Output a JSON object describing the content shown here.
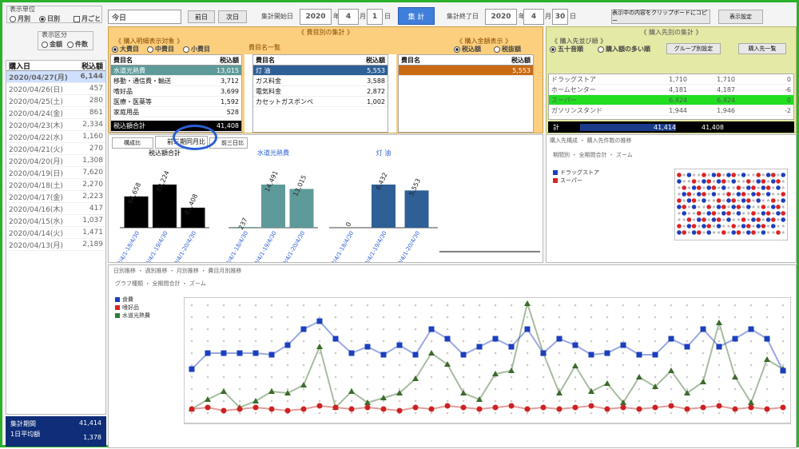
{
  "toolbar": {
    "unit_label": "表示単位",
    "radio_monthly": "月別",
    "radio_daily": "日別",
    "check_label": "月ごと",
    "period": "今日",
    "prev": "前日",
    "next": "次日",
    "start_label": "集計開始日",
    "start_year": "2020",
    "year_unit": "年",
    "start_month": "4",
    "month_unit": "月",
    "start_day": "1",
    "day_unit": "日",
    "aggregate": "集 計",
    "end_label": "集計終了日",
    "end_year": "2020",
    "end_month": "4",
    "end_day": "30",
    "copy": "表示中の内容をクリップボードにコピー",
    "settings": "表示設定",
    "mode_label": "表示区分",
    "mode_a": "金額",
    "mode_b": "件数"
  },
  "left_list": {
    "col_date": "購入日",
    "col_count": "税込額",
    "rows": [
      {
        "date": "2020/04/27(月)",
        "value": "6,144",
        "selected": true
      },
      {
        "date": "2020/04/26(日)",
        "value": "457"
      },
      {
        "date": "2020/04/25(土)",
        "value": "280"
      },
      {
        "date": "2020/04/24(金)",
        "value": "861"
      },
      {
        "date": "2020/04/23(木)",
        "value": "2,334"
      },
      {
        "date": "2020/04/22(水)",
        "value": "1,160"
      },
      {
        "date": "2020/04/21(火)",
        "value": "270"
      },
      {
        "date": "2020/04/20(月)",
        "value": "1,308"
      },
      {
        "date": "2020/04/19(日)",
        "value": "7,620"
      },
      {
        "date": "2020/04/18(土)",
        "value": "2,270"
      },
      {
        "date": "2020/04/17(金)",
        "value": "2,223"
      },
      {
        "date": "2020/04/16(木)",
        "value": "417"
      },
      {
        "date": "2020/04/15(水)",
        "value": "1,037"
      },
      {
        "date": "2020/04/14(火)",
        "value": "1,471"
      },
      {
        "date": "2020/04/13(月)",
        "value": "2,189"
      }
    ],
    "total_label": "集計期間",
    "total_value": "41,414",
    "avg_label": "1日平均額",
    "avg_value": "1,378"
  },
  "category": {
    "title": "《 費目別の集計 》",
    "type_label": "《 購入明細表示対象 》",
    "radio_large": "大費目",
    "radio_medium": "中費目",
    "radio_small": "小費目",
    "list_button": "費目名一覧",
    "amount_label": "《 購入金額表示 》",
    "radio_tax_incl": "税込額",
    "radio_tax_excl": "税抜額",
    "col_name": "費目名",
    "col_amount": "税込額",
    "large": [
      {
        "name": "水道光熱費",
        "value": "13,015",
        "selected": true
      },
      {
        "name": "移動・通信費・輸送",
        "value": "3,712"
      },
      {
        "name": "嗜好品",
        "value": "3,699"
      },
      {
        "name": "医療・医薬等",
        "value": "1,592"
      },
      {
        "name": "家庭用品",
        "value": "528"
      }
    ],
    "medium": [
      {
        "name": "灯 油",
        "value": "5,553",
        "selected": true
      },
      {
        "name": "ガス料金",
        "value": "3,588"
      },
      {
        "name": "電気料金",
        "value": "2,872"
      },
      {
        "name": "カセットガスボンベ",
        "value": "1,002"
      }
    ],
    "small": [
      {
        "name": "",
        "value": "5,553",
        "selected": true
      }
    ],
    "total_label": "税込額合計",
    "total_value": "41,408"
  },
  "compare": {
    "tab_composition": "構成比",
    "tab_same_period": "前三期同月比",
    "tab_prev3": "前三日比",
    "period_labels": [
      "18/4/1-18/4/30",
      "19/4/1-19/4/30",
      "20/4/1-20/4/30"
    ]
  },
  "chart_data": [
    {
      "type": "bar",
      "title": "税込額合計",
      "categories": [
        "18/4/1-18/4/30",
        "19/4/1-19/4/30",
        "20/4/1-20/4/30"
      ],
      "values": [
        64658,
        89224,
        41408
      ],
      "labels": [
        "64,658",
        "89,224",
        "41,408"
      ],
      "color": "#000000"
    },
    {
      "type": "bar",
      "title": "水道光熱費",
      "categories": [
        "18/4/1-18/4/30",
        "19/4/1-19/4/30",
        "20/4/1-20/4/30"
      ],
      "values": [
        237,
        14491,
        13015
      ],
      "labels": [
        "237",
        "14,491",
        "13,015"
      ],
      "color": "#5f9a9a"
    },
    {
      "type": "bar",
      "title": "灯 油",
      "categories": [
        "18/4/1-18/4/30",
        "19/4/1-19/4/30",
        "20/4/1-20/4/30"
      ],
      "values": [
        0,
        6432,
        5553
      ],
      "labels": [
        "0",
        "6,432",
        "5,553"
      ],
      "color": "#2e5f96"
    }
  ],
  "store": {
    "title": "《 購入先別の集計 》",
    "sort_label": "《 購入先並び順 》",
    "sort_a": "五十音順",
    "sort_b": "購入額の多い順",
    "group_button": "グループ別設定",
    "list_button": "購入先一覧",
    "rows": [
      {
        "name": "ドラッグストア",
        "v1": "1,710",
        "v2": "1,710",
        "v3": "0"
      },
      {
        "name": "ホームセンター",
        "v1": "4,181",
        "v2": "4,187",
        "v3": "-6"
      },
      {
        "name": "スーパー",
        "v1": "6,424",
        "v2": "6,424",
        "v3": "0",
        "selected": true
      },
      {
        "name": "ガソリンスタンド",
        "v1": "1,944",
        "v2": "1,946",
        "v3": "-2"
      }
    ],
    "total_label": "計",
    "total_value1": "41,414",
    "total_value2": "41,408"
  },
  "scatter": {
    "tabs": "購入先構成 ・ 購入先件数の推移",
    "controls": "期間別 ・ 全期間合計 ・ ズーム",
    "legend_a": "ドラッグストア",
    "legend_b": "スーパー"
  },
  "trend": {
    "tabs": "日別推移 ・ 週別推移 ・ 月別推移 ・ 費目月別推移",
    "controls": "グラフ種類 ・ 全期間合計 ・ ズーム",
    "legend_a": "食費",
    "legend_b": "嗜好品",
    "legend_c": "水道光熱費"
  }
}
